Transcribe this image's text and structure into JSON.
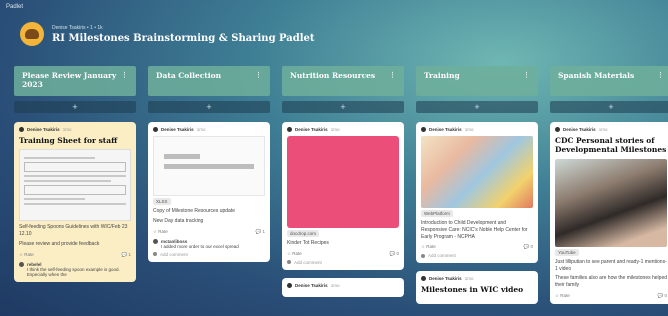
{
  "app": {
    "brand": "Padlet"
  },
  "header": {
    "owner": "Denise Tsakiris • 1 • 1k",
    "title": "RI Milestones Brainstorming & Sharing Padlet"
  },
  "columns": [
    {
      "title": "Please Review January 2023",
      "cards": [
        {
          "author": "Denise Tsakiris",
          "time": "1mo",
          "title": "Training Sheet for staff",
          "caption": "Self-feeding Spoons Guidelines with WIC/Feb 23 12.10",
          "text": "Please review and provide feedback",
          "reactions": "Rate",
          "comments": "1",
          "commenter": "rebelel",
          "comment_text": "I think the self-feeding spoon example is good. Especially when the"
        }
      ]
    },
    {
      "title": "Data Collection",
      "cards": [
        {
          "author": "Denise Tsakiris",
          "time": "1mo",
          "tag": "XLSX",
          "caption": "Copy of Milestone Resources update",
          "text": "New Day data tracking",
          "reactions": "Rate",
          "comments": "1",
          "commenter": "mctanliboss",
          "comment_text": "I added more order to our excel spread",
          "add_comment": "Add comment"
        }
      ]
    },
    {
      "title": "Nutrition Resources",
      "cards": [
        {
          "author": "Denise Tsakiris",
          "time": "1mo",
          "tag": "docdrop.com",
          "caption": "Kinder Tot Recipes",
          "reactions": "Rate",
          "comments": "0",
          "add_comment": "Add comment"
        },
        {
          "author": "Denise Tsakiris",
          "time": "1mo"
        }
      ]
    },
    {
      "title": "Training",
      "cards": [
        {
          "author": "Denise Tsakiris",
          "time": "1mo",
          "tag": "WebPlatform",
          "caption": "Introduction to Child Development and Responsive Care: NCIC's Noble Help Center for Early Program - NCPHA",
          "reactions": "Rate",
          "comments": "0",
          "add_comment": "Add comment"
        },
        {
          "author": "Denise Tsakiris",
          "time": "1mo",
          "title": "Milestones in WIC video"
        }
      ]
    },
    {
      "title": "Spanish Materials",
      "cards": [
        {
          "author": "Denise Tsakiris",
          "time": "1mo",
          "title": "CDC Personal stories of Developmental Milestones",
          "tag": "YouTube",
          "caption": "Just lilliputian to see parent and ready-1 mentions-1 video",
          "text": "These families also are how the milestones helped their family",
          "reactions": "Rate",
          "comments": "0"
        }
      ]
    }
  ]
}
